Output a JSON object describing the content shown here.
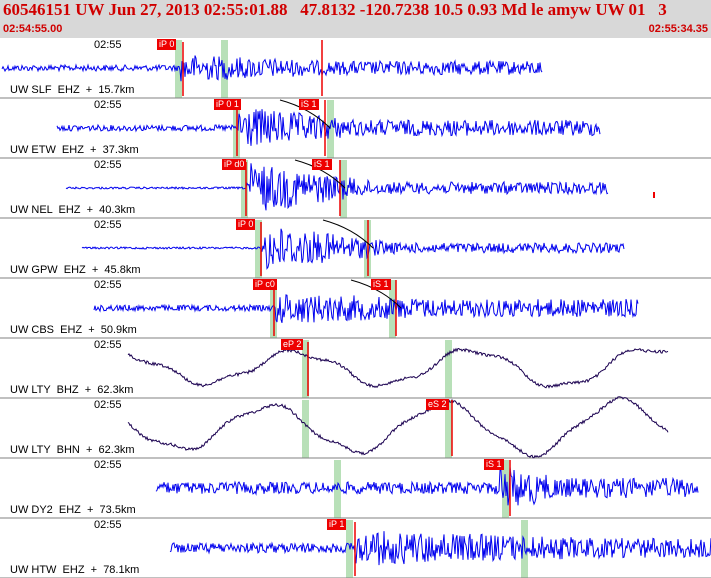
{
  "header": {
    "title": "60546151 UW Jun 27, 2013 02:55:01.88   47.8132 -120.7238 10.5 0.93 Md le amyw UW 01   3",
    "time_start": "02:54:55.00",
    "time_end": "02:55:34.35"
  },
  "colors": {
    "header_bg": "#d8d8d8",
    "header_text": "#d00000",
    "trace": "#0000ee",
    "long_period_trace": "#1a0050",
    "pick": "#ee0000",
    "pick_window": "#b8e0b8",
    "travel_time_curve": "#000000"
  },
  "panels": [
    {
      "label": "UW SLF  EHZ  +  15.7km",
      "time": "02:55",
      "p_pick": "iP 0",
      "s_pick": "",
      "type": "short"
    },
    {
      "label": "UW ETW  EHZ  +  37.3km",
      "time": "02:55",
      "p_pick": "iP 0 1",
      "s_pick": "iS 1",
      "type": "short"
    },
    {
      "label": "UW NEL  EHZ  +  40.3km",
      "time": "02:55",
      "p_pick": "iP d0",
      "s_pick": "iS 1",
      "type": "short"
    },
    {
      "label": "UW GPW  EHZ  +  45.8km",
      "time": "02:55",
      "p_pick": "iP 0",
      "s_pick": "",
      "type": "short"
    },
    {
      "label": "UW CBS  EHZ  +  50.9km",
      "time": "02:55",
      "p_pick": "iP c0",
      "s_pick": "iS 1",
      "type": "short"
    },
    {
      "label": "UW LTY  BHZ  +  62.3km",
      "time": "02:55",
      "p_pick": "eP 2",
      "s_pick": "",
      "type": "long"
    },
    {
      "label": "UW LTY  BHN  +  62.3km",
      "time": "02:55",
      "p_pick": "",
      "s_pick": "eS 2",
      "type": "long"
    },
    {
      "label": "UW DY2  EHZ  +  73.5km",
      "time": "02:55",
      "p_pick": "",
      "s_pick": "iS 1",
      "type": "short"
    },
    {
      "label": "UW HTW  EHZ  +  78.1km",
      "time": "02:55",
      "p_pick": "iP 1",
      "s_pick": "",
      "type": "short"
    }
  ]
}
